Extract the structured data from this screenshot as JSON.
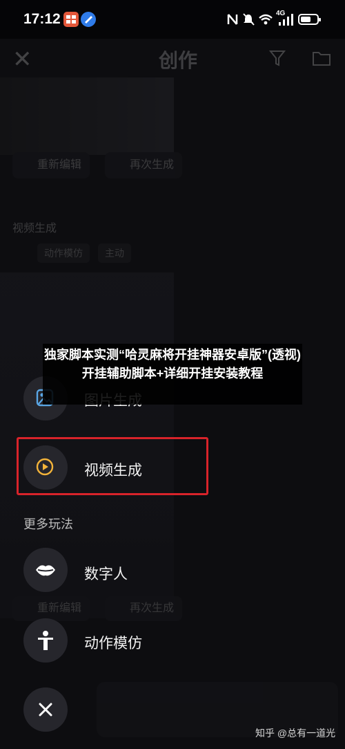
{
  "status_bar": {
    "time": "17:12",
    "network": "4G",
    "icons": [
      "nfc-icon",
      "mute-icon",
      "wifi-icon",
      "signal-icon",
      "battery-icon"
    ]
  },
  "background_page": {
    "title": "创作",
    "regenerate_edit": "重新编辑",
    "regenerate_again": "再次生成",
    "section": "视频生成",
    "tag_action": "动作模仿",
    "tag_subject": "主动",
    "bottom_regen_edit": "重新编辑",
    "bottom_regen_again": "再次生成"
  },
  "menu": {
    "image_gen": "图片生成",
    "video_gen": "视频生成",
    "more_section": "更多玩法",
    "digital_human": "数字人",
    "action_mimic": "动作模仿"
  },
  "overlay_banner": {
    "text": "独家脚本实测“哈灵麻将开挂神器安卓版”(透视)开挂辅助脚本+详细开挂安装教程"
  },
  "watermark": "知乎 @总有一道光",
  "colors": {
    "highlight_border": "#d8232a",
    "image_icon_accent": "#5aa7e6",
    "video_icon_accent": "#f4b43a"
  }
}
